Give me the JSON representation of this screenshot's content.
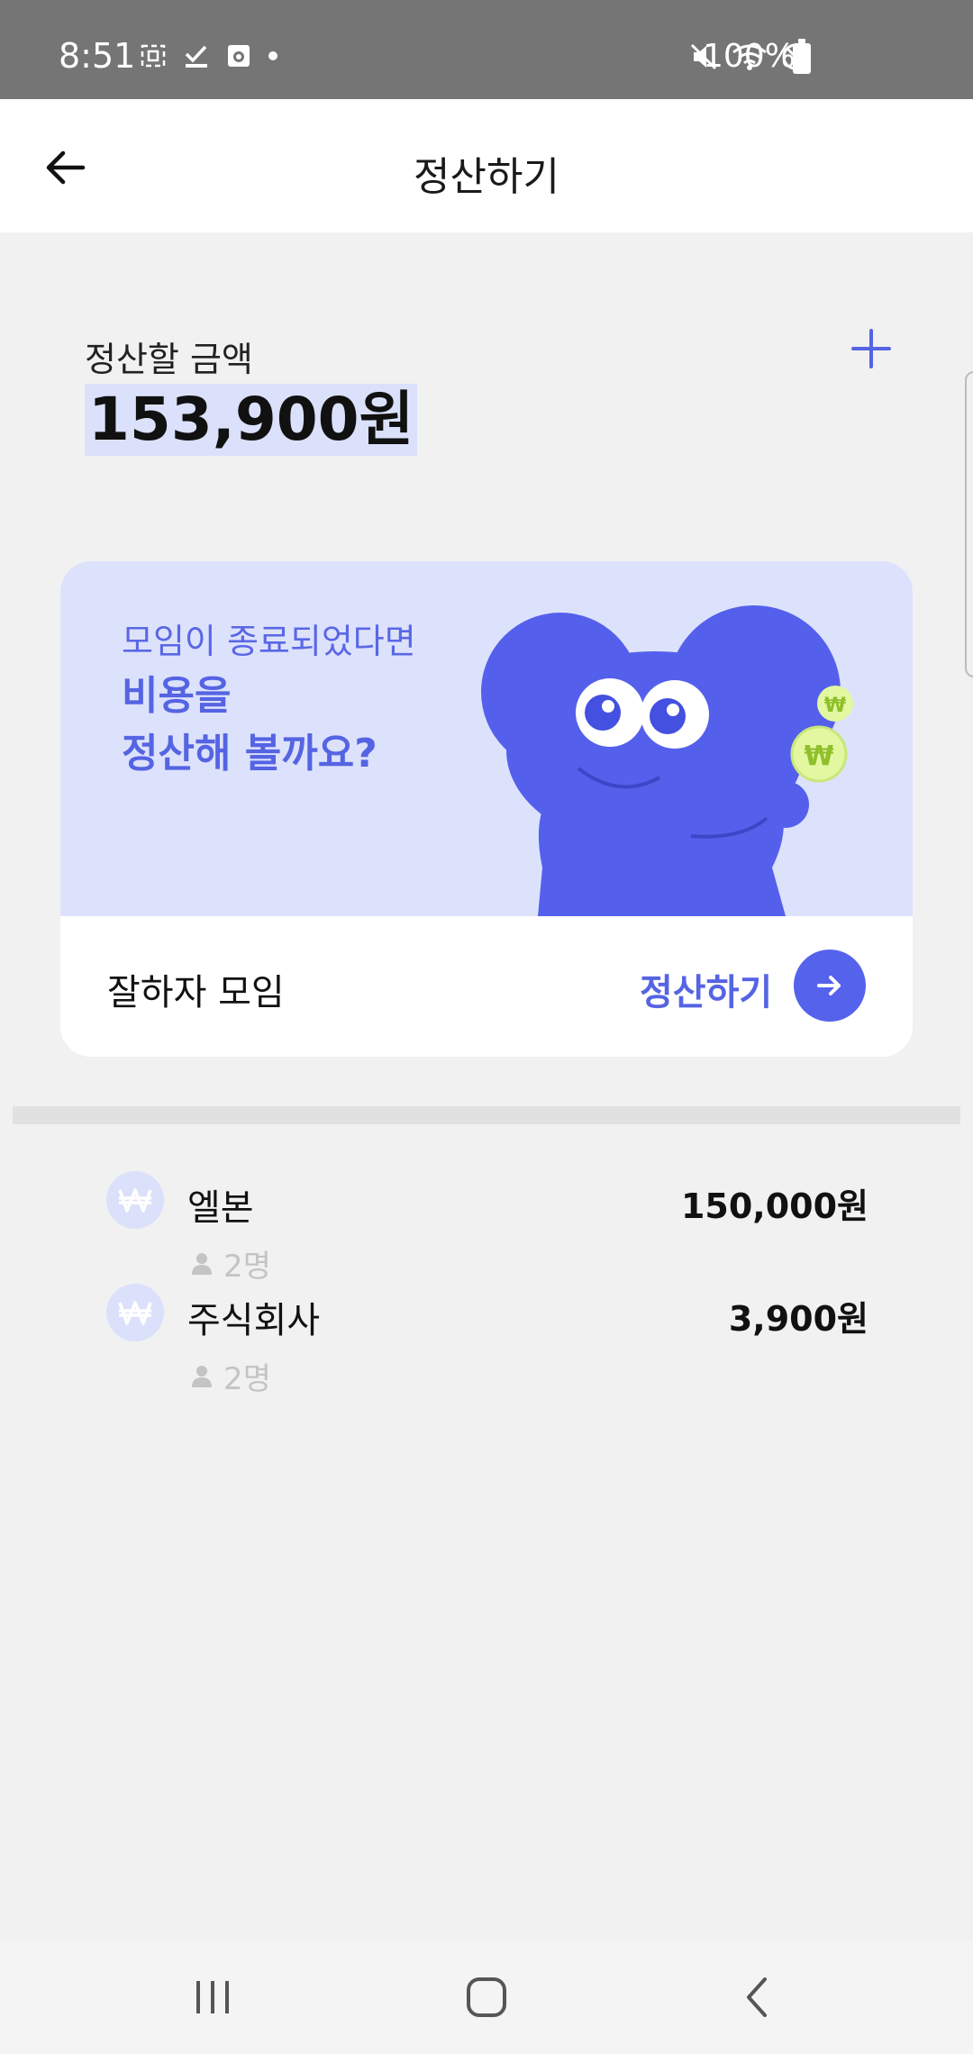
{
  "status_bar": {
    "time": "8:51",
    "battery": "100%"
  },
  "app_bar": {
    "title": "정산하기"
  },
  "summary": {
    "label": "정산할 금액",
    "amount": "153,900원"
  },
  "banner": {
    "subtitle": "모임이 종료되었다면",
    "headline_line1": "비용을",
    "headline_line2": "정산해 볼까요?"
  },
  "group_card": {
    "name": "잘하자 모임",
    "action_label": "정산하기"
  },
  "expenses": [
    {
      "icon": "won-icon",
      "name": "엘본",
      "amount": "150,000원",
      "members": "2명"
    },
    {
      "icon": "won-icon",
      "name": "주식회사",
      "amount": "3,900원",
      "members": "2명"
    }
  ],
  "colors": {
    "accent": "#5564E3",
    "banner_bg": "#DDE2FC",
    "mascot": "#5460EC",
    "coin": "#E2F7A0"
  }
}
